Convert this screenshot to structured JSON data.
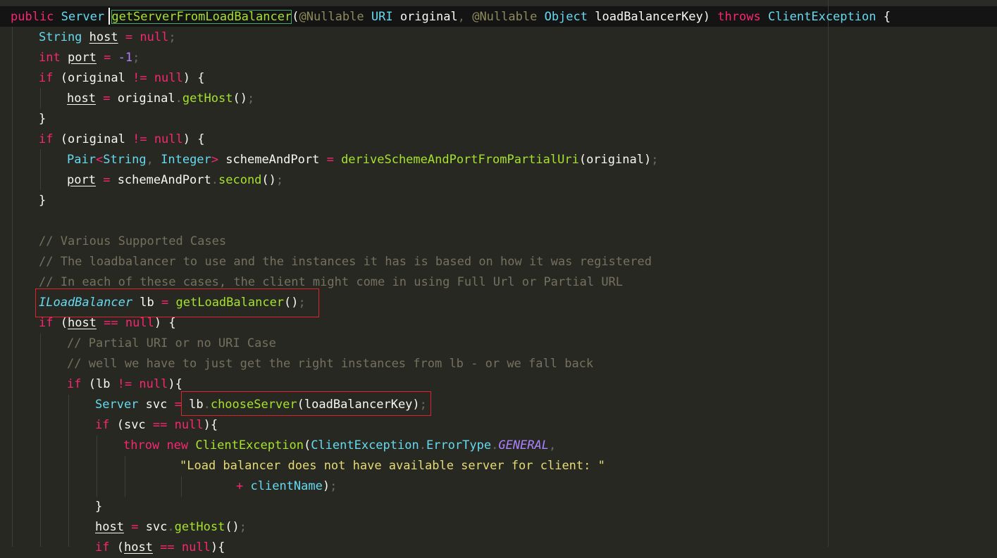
{
  "editor": {
    "signature": {
      "public_kw": "public",
      "return_type": "Server",
      "method_name": "getServerFromLoadBalancer",
      "open_paren": "(",
      "nullable1": "@Nullable",
      "uri_type": "URI",
      "param1": "original",
      "comma": ",",
      "nullable2": "@Nullable",
      "obj_type": "Object",
      "param2": "loadBalancerKey)",
      "throws_kw": "throws",
      "exception_type": "ClientException",
      "brace": "{"
    },
    "comments": {
      "c1": "// Various Supported Cases",
      "c2": "// The loadbalancer to use and the instances it has is based on how it was registered",
      "c3": "// In each of these cases, the client might come in using Full Url or Partial URL",
      "c4": "// Partial URI or no URI Case",
      "c5": "// well we have to just get the right instances from lb - or we fall back"
    },
    "strings": {
      "error_message": "\"Load balancer does not have available server for client: \""
    },
    "highlight_colors": {
      "red_box": "#e0222a",
      "method_highlight": "#4aa56c"
    }
  }
}
